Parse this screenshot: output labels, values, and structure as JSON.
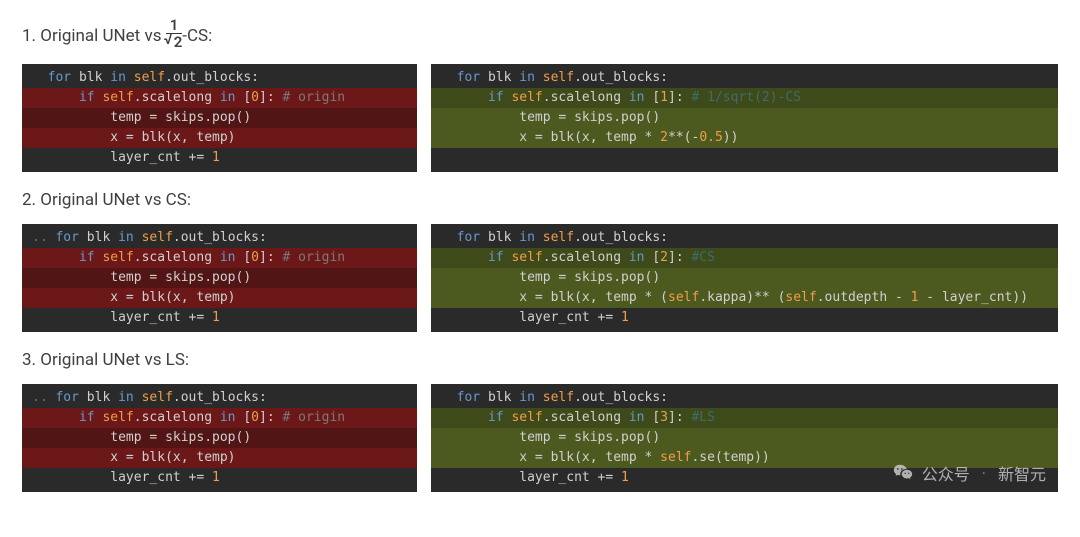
{
  "sections": [
    {
      "title_prefix": "1. Original UNet vs ",
      "title_fraction_top": "1",
      "title_fraction_bot": "2",
      "title_suffix": "-CS:",
      "left_w": "w-left",
      "right_w": "w-right",
      "left_lines": [
        {
          "bg": "",
          "dots": false,
          "tokens": [
            {
              "cls": "kw",
              "t": "for"
            },
            {
              "cls": "var",
              "t": " blk "
            },
            {
              "cls": "kw",
              "t": "in"
            },
            {
              "cls": "var",
              "t": " "
            },
            {
              "cls": "s",
              "t": "self"
            },
            {
              "cls": "var",
              "t": ".out_blocks:"
            }
          ]
        },
        {
          "bg": "bg-red",
          "pad": 1,
          "tokens": [
            {
              "cls": "kw",
              "t": "if"
            },
            {
              "cls": "var",
              "t": " "
            },
            {
              "cls": "s",
              "t": "self"
            },
            {
              "cls": "var",
              "t": ".scalelong "
            },
            {
              "cls": "kw",
              "t": "in"
            },
            {
              "cls": "var",
              "t": " ["
            },
            {
              "cls": "num",
              "t": "0"
            },
            {
              "cls": "var",
              "t": "]: "
            },
            {
              "cls": "cm",
              "t": "# origin"
            }
          ]
        },
        {
          "bg": "bg-darkred",
          "pad": 2,
          "tokens": [
            {
              "cls": "var",
              "t": "temp = skips.pop()"
            }
          ]
        },
        {
          "bg": "bg-red",
          "pad": 2,
          "tokens": [
            {
              "cls": "var",
              "t": "x = blk(x, temp)"
            }
          ]
        },
        {
          "bg": "",
          "pad": 2,
          "tokens": [
            {
              "cls": "var",
              "t": "layer_cnt += "
            },
            {
              "cls": "num",
              "t": "1"
            }
          ]
        }
      ],
      "right_lines": [
        {
          "bg": "",
          "tokens": [
            {
              "cls": "kw",
              "t": "for"
            },
            {
              "cls": "var",
              "t": " blk "
            },
            {
              "cls": "kw",
              "t": "in"
            },
            {
              "cls": "var",
              "t": " "
            },
            {
              "cls": "s",
              "t": "self"
            },
            {
              "cls": "var",
              "t": ".out_blocks:"
            }
          ]
        },
        {
          "bg": "bg-dgreen",
          "pad": 1,
          "tokens": [
            {
              "cls": "kw",
              "t": "if"
            },
            {
              "cls": "var",
              "t": " "
            },
            {
              "cls": "s",
              "t": "self"
            },
            {
              "cls": "var",
              "t": ".scalelong "
            },
            {
              "cls": "kw",
              "t": "in"
            },
            {
              "cls": "var",
              "t": " ["
            },
            {
              "cls": "num",
              "t": "1"
            },
            {
              "cls": "var",
              "t": "]: "
            },
            {
              "cls": "cm-g",
              "t": "# 1/sqrt(2)-CS"
            }
          ]
        },
        {
          "bg": "bg-green",
          "pad": 2,
          "tokens": [
            {
              "cls": "var",
              "t": "temp = skips.pop()"
            }
          ]
        },
        {
          "bg": "bg-green",
          "pad": 2,
          "tokens": [
            {
              "cls": "var",
              "t": "x = blk(x, temp * "
            },
            {
              "cls": "num",
              "t": "2"
            },
            {
              "cls": "var",
              "t": "**(-"
            },
            {
              "cls": "num",
              "t": "0.5"
            },
            {
              "cls": "var",
              "t": "))"
            }
          ]
        }
      ]
    },
    {
      "title_plain": "2. Original UNet vs CS:",
      "left_w": "w-left",
      "right_w": "w-right2",
      "left_lines": [
        {
          "bg": "",
          "dots": true,
          "tokens": [
            {
              "cls": "kw",
              "t": "for"
            },
            {
              "cls": "var",
              "t": " blk "
            },
            {
              "cls": "kw",
              "t": "in"
            },
            {
              "cls": "var",
              "t": " "
            },
            {
              "cls": "s",
              "t": "self"
            },
            {
              "cls": "var",
              "t": ".out_blocks:"
            }
          ]
        },
        {
          "bg": "bg-red",
          "pad": 1,
          "tokens": [
            {
              "cls": "kw",
              "t": "if"
            },
            {
              "cls": "var",
              "t": " "
            },
            {
              "cls": "s",
              "t": "self"
            },
            {
              "cls": "var",
              "t": ".scalelong "
            },
            {
              "cls": "kw",
              "t": "in"
            },
            {
              "cls": "var",
              "t": " ["
            },
            {
              "cls": "num",
              "t": "0"
            },
            {
              "cls": "var",
              "t": "]: "
            },
            {
              "cls": "cm",
              "t": "# origin"
            }
          ]
        },
        {
          "bg": "bg-darkred",
          "pad": 2,
          "tokens": [
            {
              "cls": "var",
              "t": "temp = skips.pop()"
            }
          ]
        },
        {
          "bg": "bg-red",
          "pad": 2,
          "tokens": [
            {
              "cls": "var",
              "t": "x = blk(x, temp)"
            }
          ]
        },
        {
          "bg": "",
          "pad": 2,
          "tokens": [
            {
              "cls": "var",
              "t": "layer_cnt += "
            },
            {
              "cls": "num",
              "t": "1"
            }
          ]
        }
      ],
      "right_lines": [
        {
          "bg": "",
          "tokens": [
            {
              "cls": "kw",
              "t": "for"
            },
            {
              "cls": "var",
              "t": " blk "
            },
            {
              "cls": "kw",
              "t": "in"
            },
            {
              "cls": "var",
              "t": " "
            },
            {
              "cls": "s",
              "t": "self"
            },
            {
              "cls": "var",
              "t": ".out_blocks:"
            }
          ]
        },
        {
          "bg": "bg-dgreen",
          "pad": 1,
          "tokens": [
            {
              "cls": "kw",
              "t": "if"
            },
            {
              "cls": "var",
              "t": " "
            },
            {
              "cls": "s",
              "t": "self"
            },
            {
              "cls": "var",
              "t": ".scalelong "
            },
            {
              "cls": "kw",
              "t": "in"
            },
            {
              "cls": "var",
              "t": " ["
            },
            {
              "cls": "num",
              "t": "2"
            },
            {
              "cls": "var",
              "t": "]: "
            },
            {
              "cls": "cm-g",
              "t": "#CS"
            }
          ]
        },
        {
          "bg": "bg-green",
          "pad": 2,
          "tokens": [
            {
              "cls": "var",
              "t": "temp = skips.pop()"
            }
          ]
        },
        {
          "bg": "bg-green",
          "pad": 2,
          "tokens": [
            {
              "cls": "var",
              "t": "x = blk(x, temp * ("
            },
            {
              "cls": "s",
              "t": "self"
            },
            {
              "cls": "var",
              "t": ".kappa)** ("
            },
            {
              "cls": "s",
              "t": "self"
            },
            {
              "cls": "var",
              "t": ".outdepth - "
            },
            {
              "cls": "num",
              "t": "1"
            },
            {
              "cls": "var",
              "t": " - layer_cnt))"
            }
          ]
        },
        {
          "bg": "",
          "pad": 2,
          "tokens": [
            {
              "cls": "var",
              "t": "layer_cnt += "
            },
            {
              "cls": "num",
              "t": "1"
            }
          ]
        }
      ]
    },
    {
      "title_plain": "3. Original UNet vs LS:",
      "left_w": "w-left",
      "right_w": "w-right",
      "left_lines": [
        {
          "bg": "",
          "dots": true,
          "tokens": [
            {
              "cls": "kw",
              "t": "for"
            },
            {
              "cls": "var",
              "t": " blk "
            },
            {
              "cls": "kw",
              "t": "in"
            },
            {
              "cls": "var",
              "t": " "
            },
            {
              "cls": "s",
              "t": "self"
            },
            {
              "cls": "var",
              "t": ".out_blocks:"
            }
          ]
        },
        {
          "bg": "bg-red",
          "pad": 1,
          "tokens": [
            {
              "cls": "kw",
              "t": "if"
            },
            {
              "cls": "var",
              "t": " "
            },
            {
              "cls": "s",
              "t": "self"
            },
            {
              "cls": "var",
              "t": ".scalelong "
            },
            {
              "cls": "kw",
              "t": "in"
            },
            {
              "cls": "var",
              "t": " ["
            },
            {
              "cls": "num",
              "t": "0"
            },
            {
              "cls": "var",
              "t": "]: "
            },
            {
              "cls": "cm",
              "t": "# origin"
            }
          ]
        },
        {
          "bg": "bg-darkred",
          "pad": 2,
          "tokens": [
            {
              "cls": "var",
              "t": "temp = skips.pop()"
            }
          ]
        },
        {
          "bg": "bg-red",
          "pad": 2,
          "tokens": [
            {
              "cls": "var",
              "t": "x = blk(x, temp)"
            }
          ]
        },
        {
          "bg": "",
          "pad": 2,
          "tokens": [
            {
              "cls": "var",
              "t": "layer_cnt += "
            },
            {
              "cls": "num",
              "t": "1"
            }
          ]
        }
      ],
      "right_lines": [
        {
          "bg": "",
          "tokens": [
            {
              "cls": "kw",
              "t": "for"
            },
            {
              "cls": "var",
              "t": " blk "
            },
            {
              "cls": "kw",
              "t": "in"
            },
            {
              "cls": "var",
              "t": " "
            },
            {
              "cls": "s",
              "t": "self"
            },
            {
              "cls": "var",
              "t": ".out_blocks:"
            }
          ]
        },
        {
          "bg": "bg-dgreen",
          "pad": 1,
          "tokens": [
            {
              "cls": "kw",
              "t": "if"
            },
            {
              "cls": "var",
              "t": " "
            },
            {
              "cls": "s",
              "t": "self"
            },
            {
              "cls": "var",
              "t": ".scalelong "
            },
            {
              "cls": "kw",
              "t": "in"
            },
            {
              "cls": "var",
              "t": " ["
            },
            {
              "cls": "num",
              "t": "3"
            },
            {
              "cls": "var",
              "t": "]: "
            },
            {
              "cls": "cm-g",
              "t": "#LS"
            }
          ]
        },
        {
          "bg": "bg-green",
          "pad": 2,
          "tokens": [
            {
              "cls": "var",
              "t": "temp = skips.pop()"
            }
          ]
        },
        {
          "bg": "bg-green",
          "pad": 2,
          "tokens": [
            {
              "cls": "var",
              "t": "x = blk(x, temp * "
            },
            {
              "cls": "s",
              "t": "self"
            },
            {
              "cls": "var",
              "t": ".se(temp))"
            }
          ]
        },
        {
          "bg": "",
          "pad": 2,
          "tokens": [
            {
              "cls": "var",
              "t": "layer_cnt += "
            },
            {
              "cls": "num",
              "t": "1"
            }
          ]
        }
      ]
    }
  ],
  "watermark": {
    "prefix": "公众号",
    "name": "新智元"
  }
}
